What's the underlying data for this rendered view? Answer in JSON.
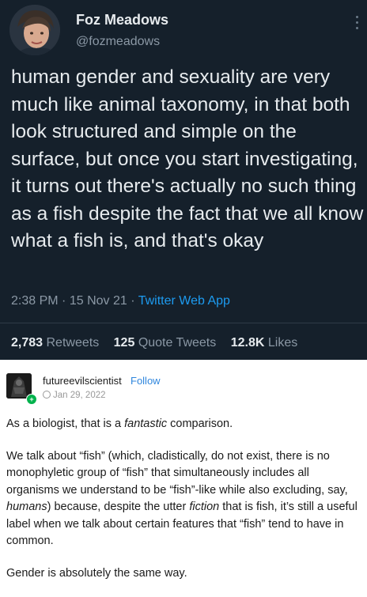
{
  "tweet": {
    "author_name": "Foz Meadows",
    "author_handle": "@fozmeadows",
    "text": "human gender and sexuality are very much like animal taxonomy, in that both look structured and simple on the surface, but once you start investigating, it turns out there's actually no such thing as a fish despite the fact that we all know what a fish is, and that's okay",
    "time": "2:38 PM",
    "date": "15 Nov 21",
    "app": "Twitter Web App",
    "retweets_count": "2,783",
    "retweets_label": "Retweets",
    "quote_count": "125",
    "quote_label": "Quote Tweets",
    "likes_count": "12.8K",
    "likes_label": "Likes"
  },
  "post": {
    "username": "futureevilscientist",
    "follow_label": "Follow",
    "date": "Jan 29, 2022",
    "p1_a": "As a biologist, that is a ",
    "p1_em": "fantastic",
    "p1_b": " comparison.",
    "p2_a": "We talk about “fish” (which, cladistically, do not exist, there is no monophyletic group of “fish” that simultaneously includes all organisms we understand to be “fish”-like while also excluding, say, ",
    "p2_em1": "humans",
    "p2_b": ") because, despite the utter ",
    "p2_em2": "fiction",
    "p2_c": " that is fish, it’s still a useful label when we talk about certain features that “fish” tend to have in common.",
    "p3": "Gender is absolutely the same way."
  },
  "colors": {
    "tweet_bg": "#15202b",
    "link_blue": "#1d9bf0",
    "follow_blue": "#2f86dd",
    "badge_green": "#00b24c"
  }
}
